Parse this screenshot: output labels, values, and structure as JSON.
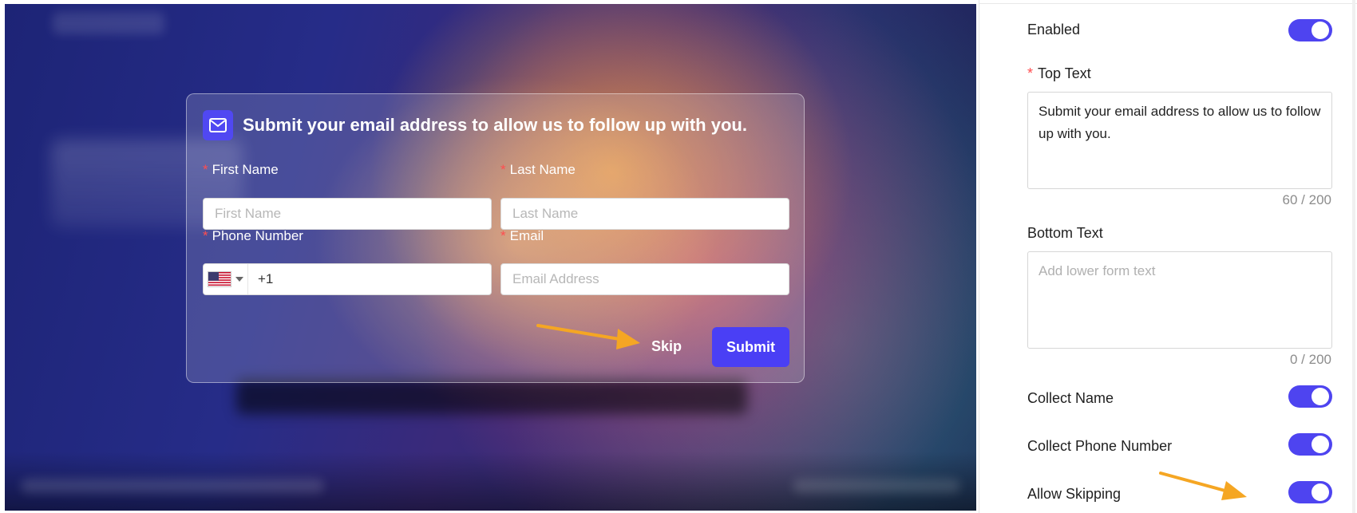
{
  "form": {
    "title": "Submit your email address to allow us to follow up with you.",
    "first_name": {
      "label": "First Name",
      "placeholder": "First Name",
      "required_mark": "*"
    },
    "last_name": {
      "label": "Last Name",
      "placeholder": "Last Name",
      "required_mark": "*"
    },
    "phone": {
      "label": "Phone Number",
      "value": "+1",
      "country": "US",
      "required_mark": "*"
    },
    "email": {
      "label": "Email",
      "placeholder": "Email Address",
      "required_mark": "*"
    },
    "skip_label": "Skip",
    "submit_label": "Submit",
    "accent": "#4a3ff5"
  },
  "settings": {
    "enabled": {
      "label": "Enabled",
      "on": true
    },
    "top_text": {
      "label": "Top Text",
      "required_mark": "*",
      "value": "Submit your email address to allow us to follow up with you.",
      "counter": "60 / 200"
    },
    "bottom_text": {
      "label": "Bottom Text",
      "placeholder": "Add lower form text",
      "value": "",
      "counter": "0 / 200"
    },
    "collect_name": {
      "label": "Collect Name",
      "on": true
    },
    "collect_phone": {
      "label": "Collect Phone Number",
      "on": true
    },
    "allow_skipping": {
      "label": "Allow Skipping",
      "on": true
    },
    "toggle_color": "#4e44f0",
    "annotation_arrow_color": "#f5a623"
  }
}
